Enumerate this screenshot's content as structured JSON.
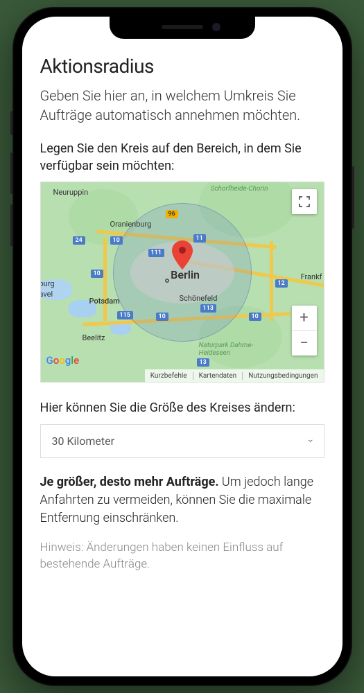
{
  "screen": {
    "title": "Aktionsradius",
    "subtitle": "Geben Sie hier an, in welchem Umkreis Sie Aufträge automatisch annehmen möchten.",
    "map_label": "Legen Sie den Kreis auf den Bereich, in dem Sie verfügbar sein möchten:",
    "size_label": "Hier können Sie die Größe des Kreises ändern:",
    "select_value": "30 Kilometer",
    "explain_bold": "Je größer, desto mehr Aufträge.",
    "explain_text": " Um jedoch lange Anfahrten zu vermeiden, können Sie die maximale Entfernung einschränken.",
    "hint": "Hinweis: Änderungen haben keinen Einfluss auf bestehende Aufträge."
  },
  "map": {
    "center_city": "Berlin",
    "cities": {
      "neuruppin": "Neuruppin",
      "oranienburg": "Oranienburg",
      "potsdam": "Potsdam",
      "schoenefeld": "Schönefeld",
      "beelitz": "Beelitz",
      "frankfurt": "Frankf",
      "branden": "burg",
      "havel": "avel"
    },
    "natural": {
      "schorfheide": "Schorfheide-Chorin",
      "dahme": "Naturpark Dahme-Heideseen"
    },
    "shields": {
      "a10_1": "10",
      "a10_2": "10",
      "a10_3": "10",
      "a10_4": "10",
      "a11": "11",
      "a111": "111",
      "a113": "113",
      "a115": "115",
      "a12": "12",
      "a13": "13",
      "a24": "24",
      "b96": "96"
    },
    "footer": {
      "shortcuts": "Kurzbefehle",
      "mapdata": "Kartendaten",
      "terms": "Nutzungsbedingungen"
    },
    "provider": "Google"
  }
}
